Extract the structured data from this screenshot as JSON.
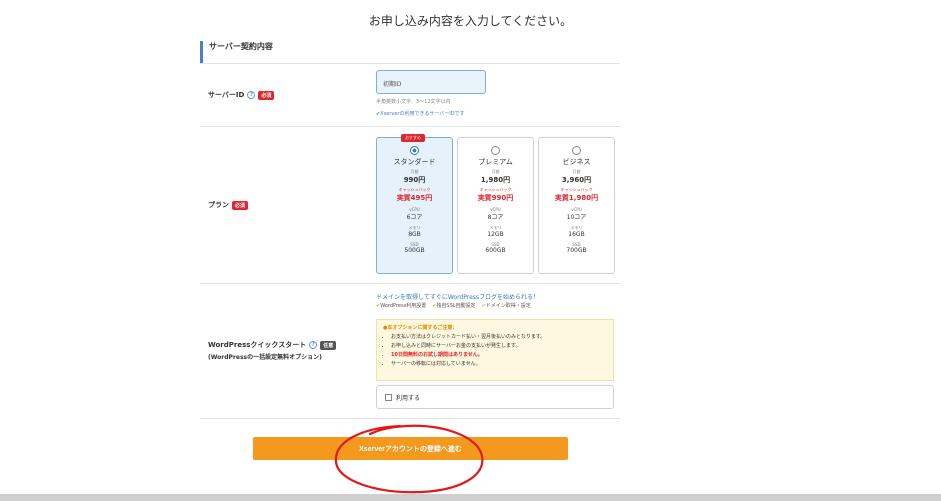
{
  "heading": "お申し込み内容を入力してください。",
  "section_title": "サーバー契約内容",
  "server_id": {
    "label": "サーバーID",
    "required": "必須",
    "value": "初期ID",
    "hint": "半角英数小文字、3～12文字以内",
    "check_note": "Xserverの利用できるサーバーIDです"
  },
  "plan": {
    "label": "プラン",
    "required": "必須",
    "recommended_badge": "おすすめ",
    "items": [
      {
        "name": "スタンダード",
        "period": "月額",
        "price": "990円",
        "campaign": "キャッシュバック",
        "sale": "実質495円",
        "cpu_label": "vCPU",
        "cpu": "6コア",
        "mem_label": "メモリ",
        "mem": "8GB",
        "ssd_label": "SSD",
        "ssd": "500GB"
      },
      {
        "name": "プレミアム",
        "period": "月額",
        "price": "1,980円",
        "campaign": "キャッシュバック",
        "sale": "実質990円",
        "cpu_label": "vCPU",
        "cpu": "8コア",
        "mem_label": "メモリ",
        "mem": "12GB",
        "ssd_label": "SSD",
        "ssd": "600GB"
      },
      {
        "name": "ビジネス",
        "period": "月額",
        "price": "3,960円",
        "campaign": "キャッシュバック",
        "sale": "実質1,980円",
        "cpu_label": "vCPU",
        "cpu": "10コア",
        "mem_label": "メモリ",
        "mem": "16GB",
        "ssd_label": "SSD",
        "ssd": "700GB"
      }
    ]
  },
  "wordpress": {
    "label": "WordPressクイックスタート",
    "sub_label": "(WordPressの一括設定無料オプション)",
    "badge": "任意",
    "lead": "ドメインを取得してすぐにWordPressブログを始められる！",
    "features": [
      "WordPress利用設置",
      "独自SSL自動設定",
      "ドメイン取得・設定"
    ],
    "notice_title": "本オプションに関するご注意：",
    "notices": [
      "お支払い方法はクレジットカード払い・翌月後払いのみとなります。",
      "お申し込みと同時にサーバーお金の支払いが発生します。",
      "10日間無料のお試し期間はありません。",
      "サーバーの移転には対応していません。"
    ],
    "use_label": "利用する"
  },
  "submit_label": "Xserverアカウントの登録へ進む"
}
